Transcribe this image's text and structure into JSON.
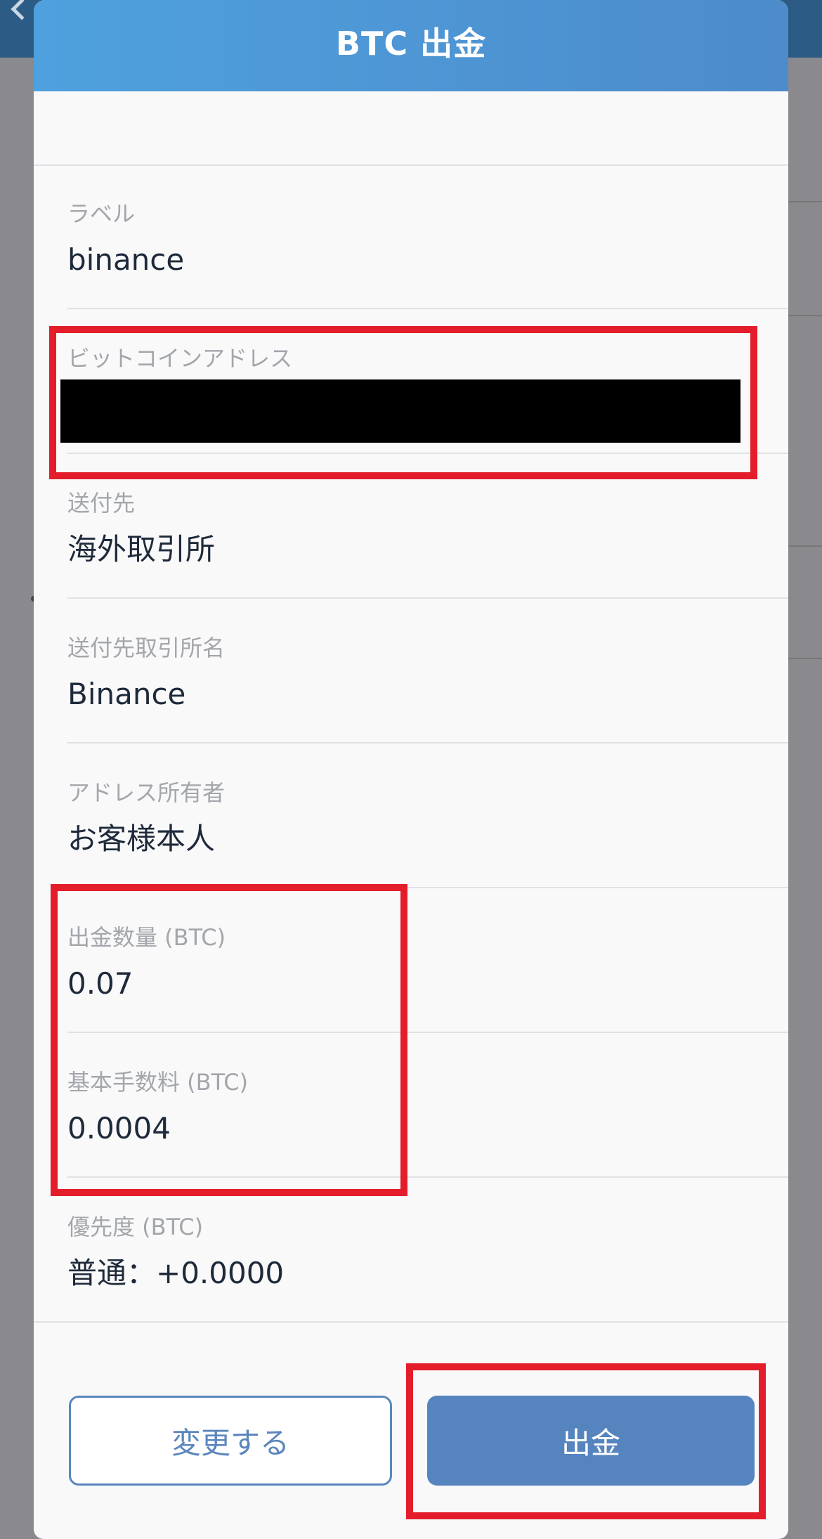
{
  "modal": {
    "title": "BTC 出金"
  },
  "fields": [
    {
      "label": "ラベル",
      "value": "binance"
    },
    {
      "label": "ビットコインアドレス",
      "value": ""
    },
    {
      "label": "送付先",
      "value": "海外取引所"
    },
    {
      "label": "送付先取引所名",
      "value": "Binance"
    },
    {
      "label": "アドレス所有者",
      "value": "お客様本人"
    },
    {
      "label": "出金数量 (BTC)",
      "value": "0.07"
    },
    {
      "label": "基本手数料 (BTC)",
      "value": "0.0004"
    },
    {
      "label": "優先度 (BTC)",
      "value": "普通：+0.0000"
    }
  ],
  "buttons": {
    "change_label": "変更する",
    "withdraw_label": "出金"
  },
  "colors": {
    "header_gradient_start": "#4ea1de",
    "header_gradient_end": "#4d8bcb",
    "primary_button": "#5584bf",
    "highlight_red": "#e31e2a",
    "label_gray": "#a3a6ab",
    "value_dark": "#1e2a3a"
  }
}
